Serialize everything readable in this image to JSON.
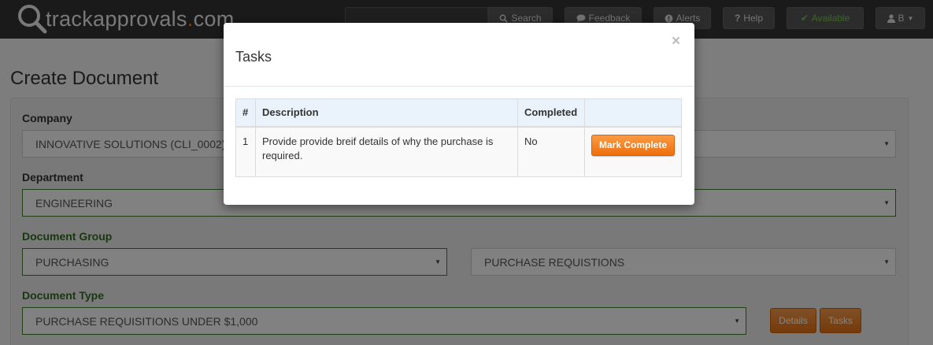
{
  "navbar": {
    "logo_text": "trackapprovals",
    "logo_dot": ".",
    "logo_suffix": "com",
    "search_label": "Search",
    "feedback_label": "Feedback",
    "alerts_label": "Alerts",
    "help_label": "Help",
    "available_label": "Available",
    "user_label": "B",
    "accent_color": "#f07a1b",
    "available_color": "#6ec24a"
  },
  "page": {
    "title": "Create Document"
  },
  "form": {
    "company_label": "Company",
    "company_value": "INNOVATIVE SOLUTIONS (CLI_0002)",
    "department_label": "Department",
    "department_value": "ENGINEERING",
    "doc_group_label": "Document Group",
    "doc_group_value": "PURCHASING",
    "doc_subgroup_value": "PURCHASE REQUISTIONS",
    "doc_type_label": "Document Type",
    "doc_type_value": "PURCHASE REQUISITIONS UNDER $1,000",
    "details_button": "Details",
    "tasks_button": "Tasks"
  },
  "modal": {
    "title": "Tasks",
    "close_symbol": "×",
    "table": {
      "headers": [
        "#",
        "Description",
        "Completed",
        ""
      ],
      "rows": [
        {
          "num": "1",
          "description": "Provide provide breif details of why the purchase is required.",
          "completed": "No",
          "action_label": "Mark Complete"
        }
      ]
    }
  }
}
